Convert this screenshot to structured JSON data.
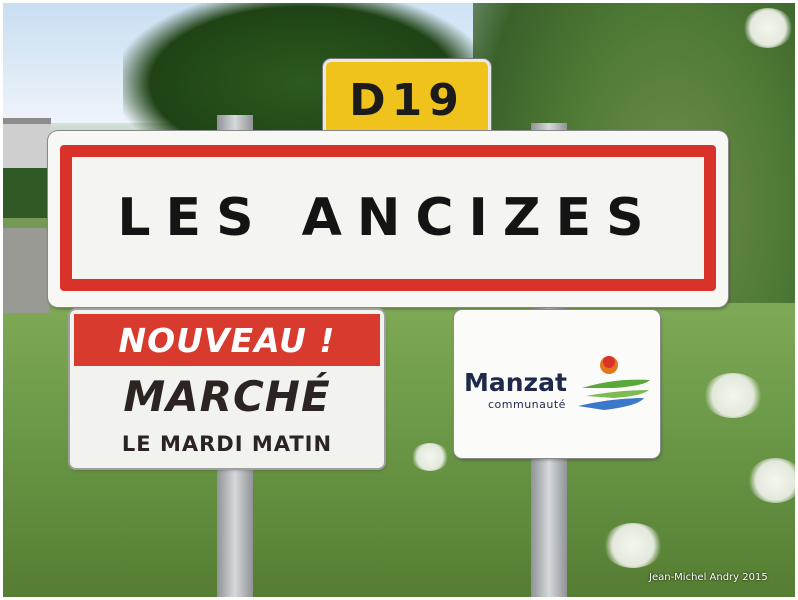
{
  "road_number_sign": {
    "text": "D19",
    "color": "#f0c21c"
  },
  "town_sign": {
    "name": "LES ANCIZES",
    "border_color": "#d9322b"
  },
  "market_sign": {
    "headline": "NOUVEAU !",
    "title": "MARCHÉ",
    "subtitle": "LE MARDI MATIN",
    "banner_color": "#d93a2e"
  },
  "community_sign": {
    "name": "Manzat",
    "tagline": "communauté"
  },
  "photo_credit": "Jean-Michel Andry 2015"
}
